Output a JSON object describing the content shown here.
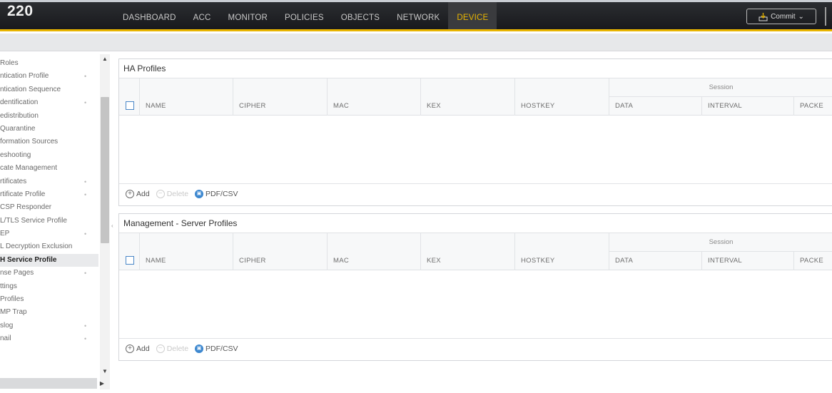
{
  "header": {
    "brand": "220",
    "tabs": [
      {
        "label": "DASHBOARD",
        "active": false
      },
      {
        "label": "ACC",
        "active": false
      },
      {
        "label": "MONITOR",
        "active": false
      },
      {
        "label": "POLICIES",
        "active": false
      },
      {
        "label": "OBJECTS",
        "active": false
      },
      {
        "label": "NETWORK",
        "active": false
      },
      {
        "label": "DEVICE",
        "active": true
      }
    ],
    "commit_label": "Commit",
    "accent_color": "#e8b400"
  },
  "sidebar": {
    "items": [
      {
        "label": "Roles",
        "dot": ""
      },
      {
        "label": "ntication Profile",
        "dot": "•"
      },
      {
        "label": "ntication Sequence",
        "dot": ""
      },
      {
        "label": "dentification",
        "dot": "•"
      },
      {
        "label": "edistribution",
        "dot": ""
      },
      {
        "label": "Quarantine",
        "dot": ""
      },
      {
        "label": "formation Sources",
        "dot": ""
      },
      {
        "label": "eshooting",
        "dot": ""
      },
      {
        "label": "cate Management",
        "dot": ""
      },
      {
        "label": "rtificates",
        "dot": "•"
      },
      {
        "label": "rtificate Profile",
        "dot": "•"
      },
      {
        "label": "CSP Responder",
        "dot": ""
      },
      {
        "label": "L/TLS Service Profile",
        "dot": ""
      },
      {
        "label": "EP",
        "dot": "•"
      },
      {
        "label": "L Decryption Exclusion",
        "dot": ""
      },
      {
        "label": "H Service Profile",
        "dot": "",
        "active": true
      },
      {
        "label": "nse Pages",
        "dot": "•"
      },
      {
        "label": "ttings",
        "dot": ""
      },
      {
        "label": "Profiles",
        "dot": ""
      },
      {
        "label": "MP Trap",
        "dot": ""
      },
      {
        "label": "slog",
        "dot": "•"
      },
      {
        "label": "nail",
        "dot": "•"
      }
    ]
  },
  "panels": {
    "ha": {
      "title": "HA Profiles"
    },
    "mgmt": {
      "title": "Management - Server Profiles"
    }
  },
  "table": {
    "columns": [
      "NAME",
      "CIPHER",
      "MAC",
      "KEX",
      "HOSTKEY",
      "DATA",
      "INTERVAL",
      "PACKE"
    ],
    "group_header": "Session"
  },
  "toolbar": {
    "add_label": "Add",
    "delete_label": "Delete",
    "pdf_label": "PDF/CSV"
  }
}
